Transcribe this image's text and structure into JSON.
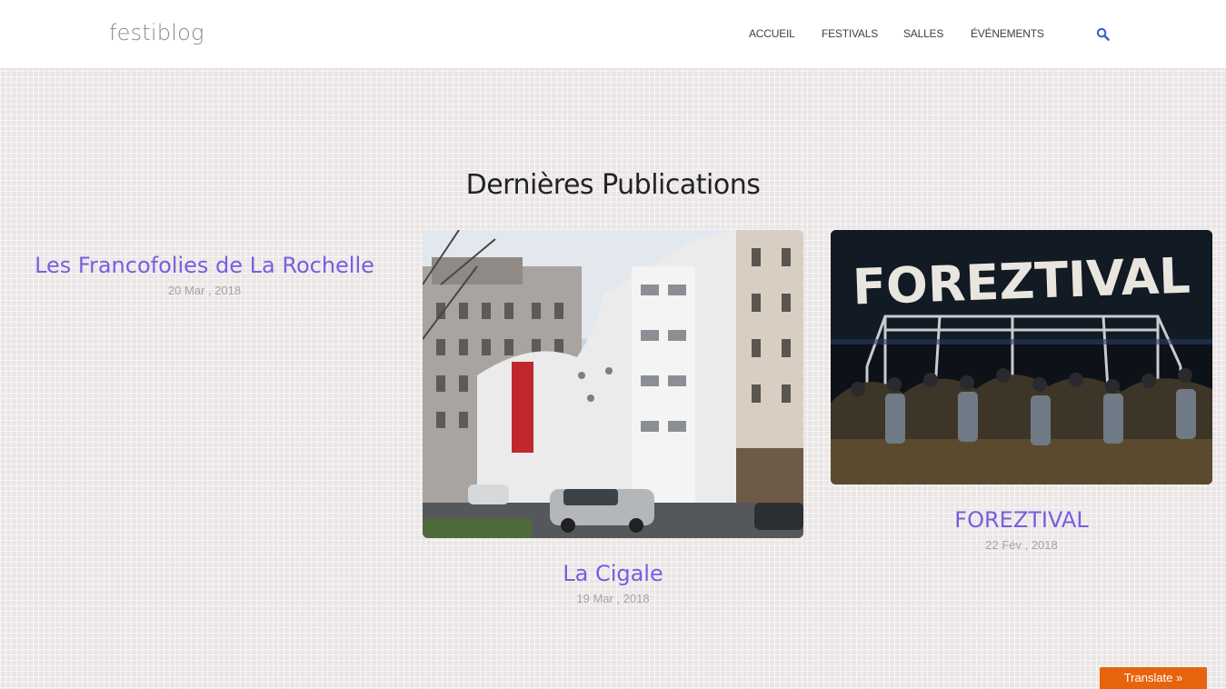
{
  "site": {
    "brand": "festiblog"
  },
  "nav": {
    "items": [
      {
        "label": "ACCUEIL"
      },
      {
        "label": "FESTIVALS"
      },
      {
        "label": "SALLES"
      },
      {
        "label": "ÉVÉNEMENTS"
      }
    ],
    "search_icon": "search-icon"
  },
  "section": {
    "title": "Dernières Publications"
  },
  "posts": [
    {
      "title": "Les Francofolies de La Rochelle",
      "date": "20 Mar , 2018"
    },
    {
      "title": "La Cigale",
      "date": "19 Mar , 2018",
      "image": "building-photo"
    },
    {
      "title": "FOREZTIVAL",
      "date": "22 Fév , 2018",
      "image": "festival-stage-photo",
      "image_text": "FOREZTIVAL"
    }
  ],
  "translate": {
    "label": "Translate »"
  },
  "colors": {
    "accent": "#7a5ce0",
    "translate": "#e8630e",
    "search": "#3a5bc7"
  }
}
